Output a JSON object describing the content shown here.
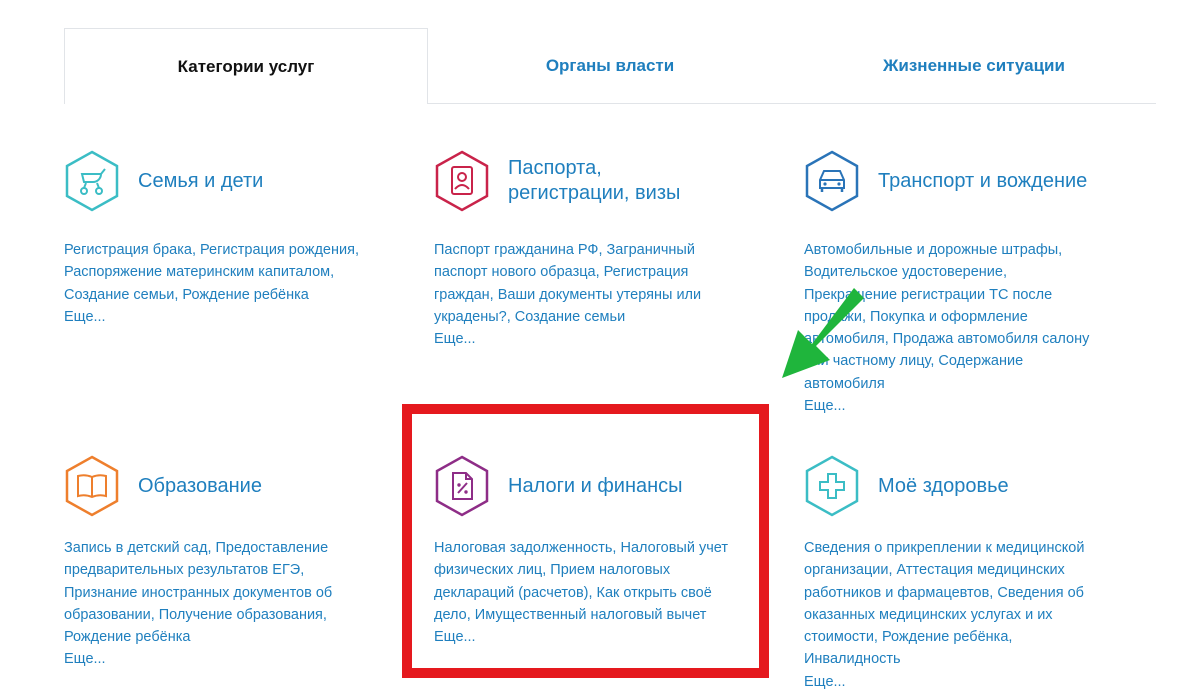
{
  "tabs": [
    {
      "label": "Категории услуг",
      "active": true
    },
    {
      "label": "Органы власти",
      "active": false
    },
    {
      "label": "Жизненные ситуации",
      "active": false
    }
  ],
  "more_label": "Еще...",
  "categories": [
    {
      "title": "Семья и дети",
      "icon": "stroller-icon",
      "color": "#3bbdc5",
      "links": "Регистрация брака, Регистрация рождения, Распоряжение материнским капиталом, Создание семьи, Рождение ребёнка"
    },
    {
      "title": "Паспорта, регистрации, визы",
      "icon": "passport-icon",
      "color": "#c9234a",
      "links": "Паспорт гражданина РФ, Заграничный паспорт нового образца, Регистрация граждан, Ваши документы утеряны или украдены?, Создание семьи"
    },
    {
      "title": "Транспорт и вождение",
      "icon": "car-icon",
      "color": "#2a74b8",
      "links": "Автомобильные и дорожные штрафы, Водительское удостоверение, Прекращение регистрации ТС после продажи, Покупка и оформление автомобиля, Продажа автомобиля салону или частному лицу, Содержание автомобиля"
    },
    {
      "title": "Образование",
      "icon": "book-icon",
      "color": "#ee7f2d",
      "links": "Запись в детский сад, Предоставление предварительных результатов ЕГЭ, Признание иностранных документов об образовании, Получение образования, Рождение ребёнка"
    },
    {
      "title": "Налоги и финансы",
      "icon": "tax-document-icon",
      "color": "#8e2d87",
      "links": "Налоговая задолженность, Налоговый учет физических лиц, Прием налоговых деклараций (расчетов), Как открыть своё дело, Имущественный налоговый вычет"
    },
    {
      "title": "Моё здоровье",
      "icon": "medical-cross-icon",
      "color": "#3bbdc5",
      "links": "Сведения о прикреплении к медицинской организации, Аттестация медицинских работников и фармацевтов, Сведения об оказанных медицинских услугах и их стоимости, Рождение ребёнка, Инвалидность"
    }
  ],
  "annotations": {
    "highlight_color": "#e5191e",
    "arrow_color": "#1fb53c"
  }
}
